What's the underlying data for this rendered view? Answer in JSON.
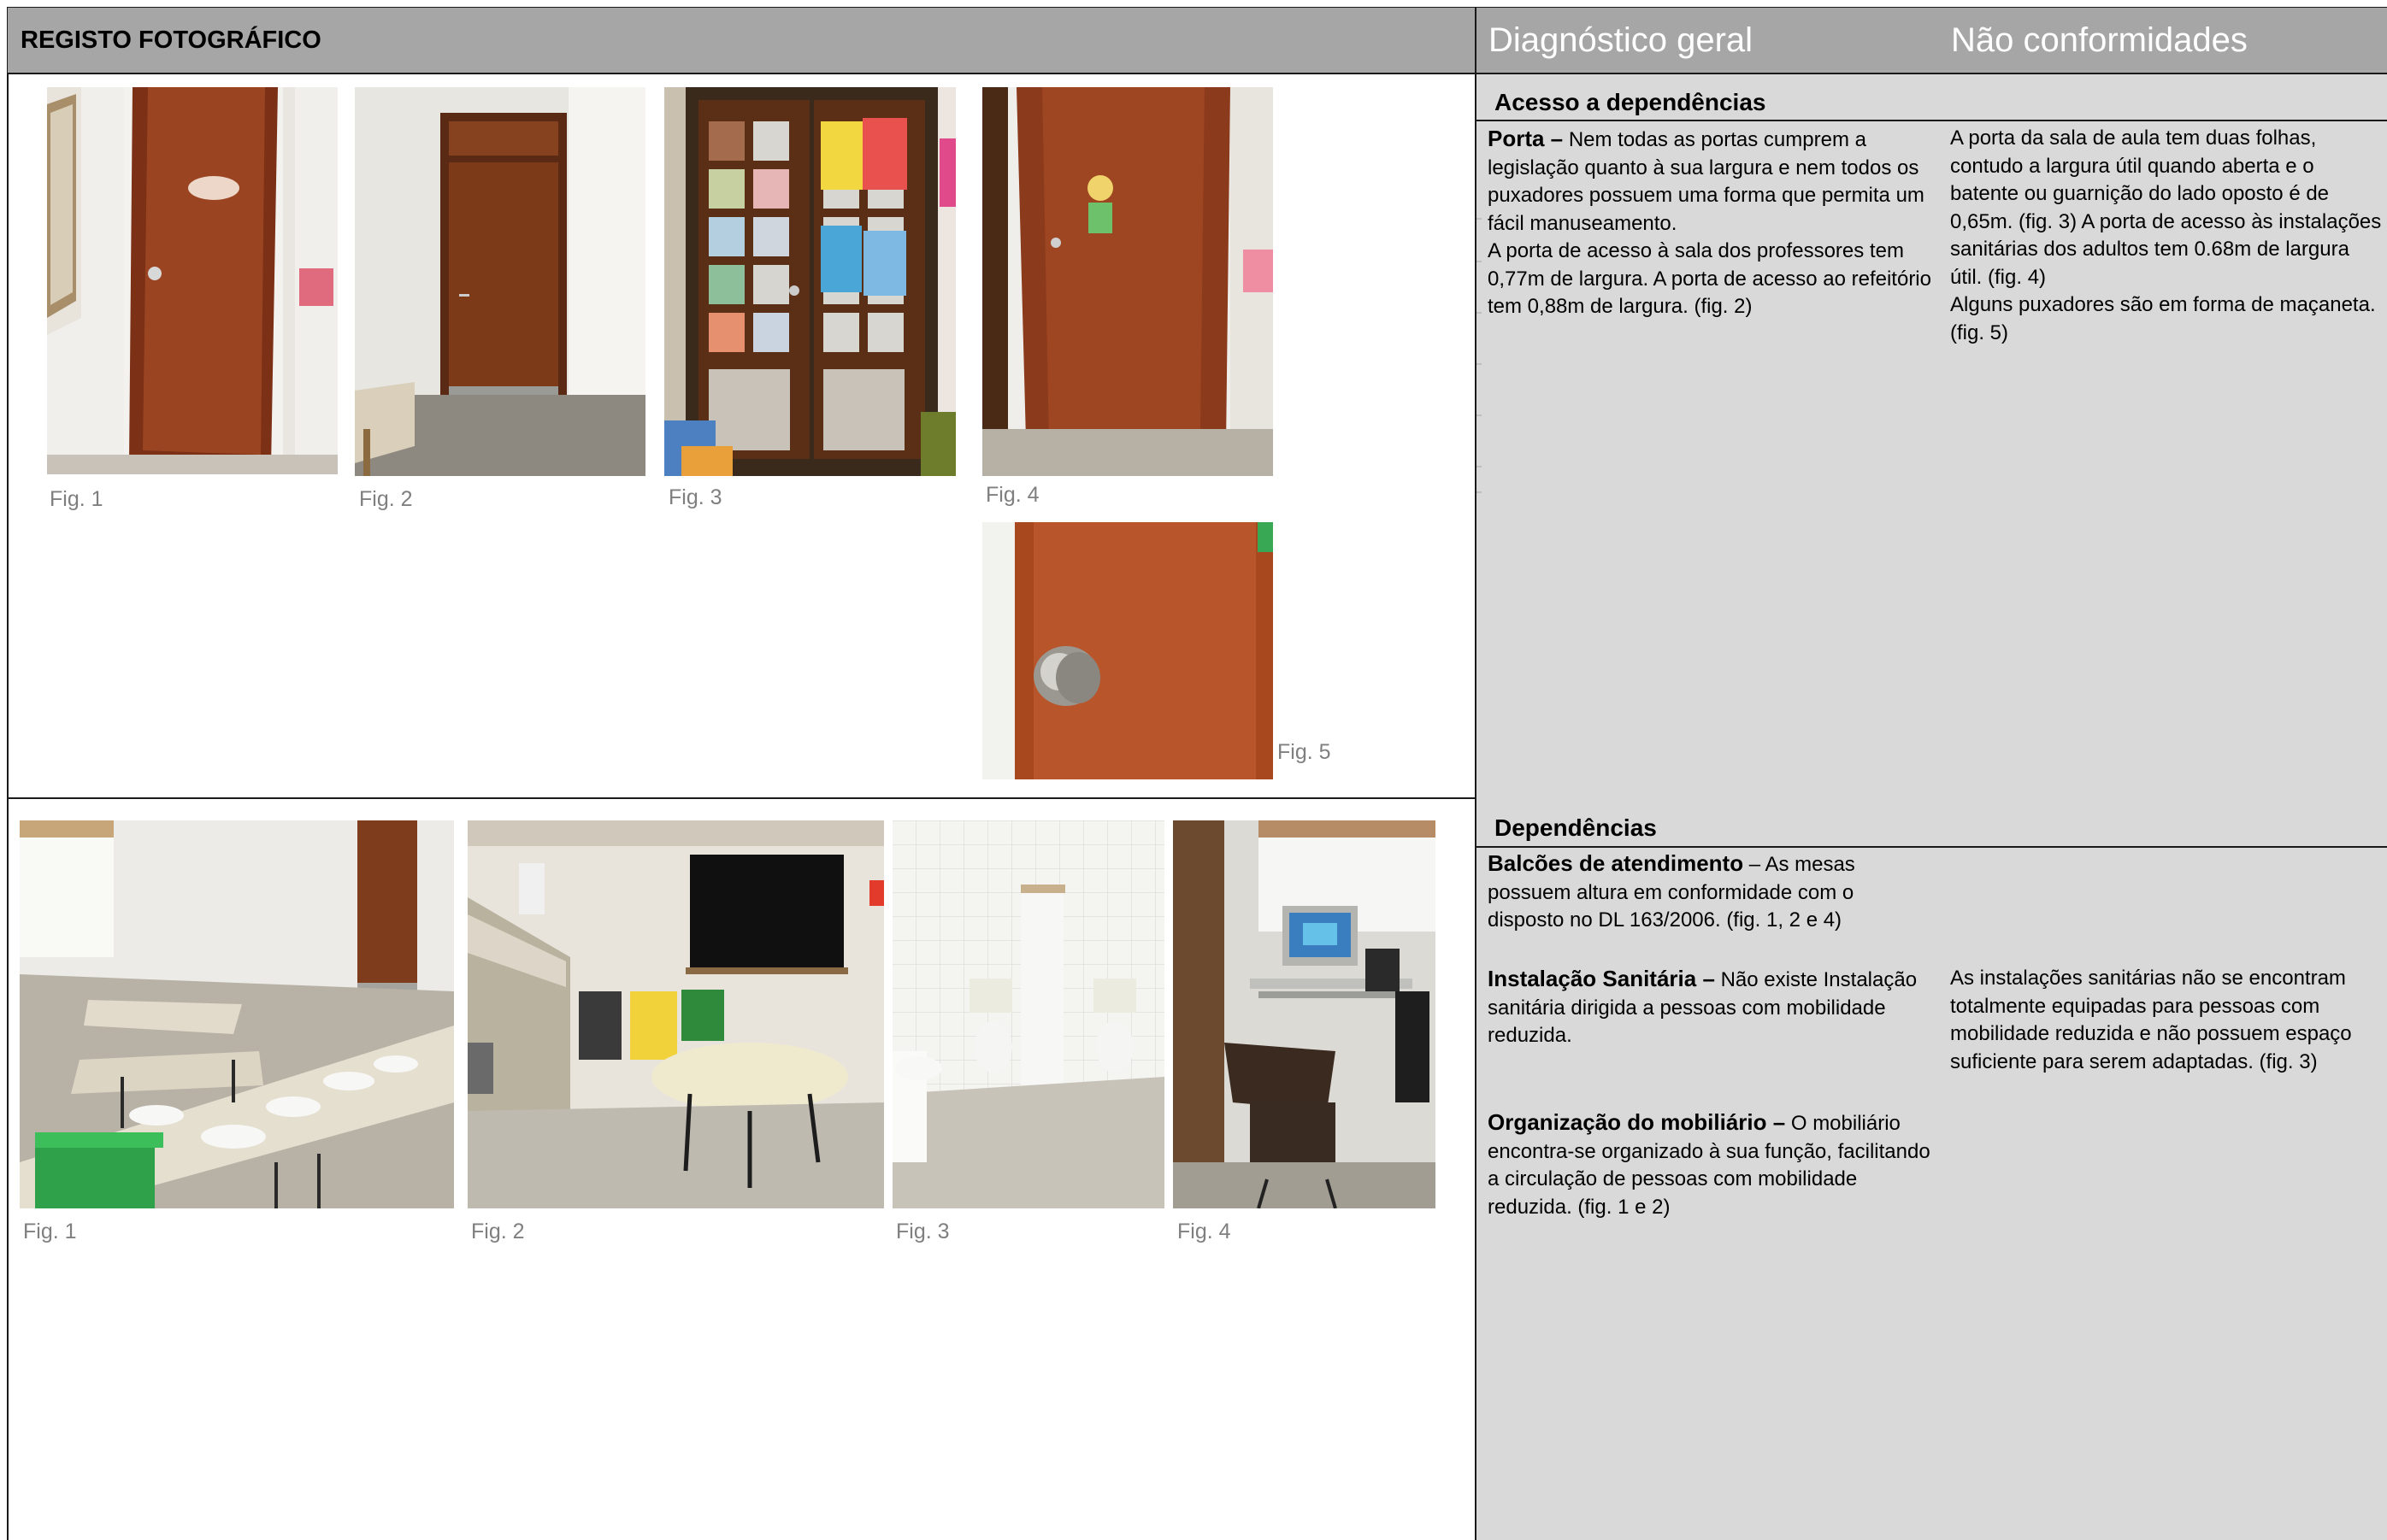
{
  "header": {
    "left_title": "REGISTO FOTOGRÁFICO",
    "col_diagnostico": "Diagnóstico geral",
    "col_nao_conformidades": "Não conformidades"
  },
  "section1": {
    "title": "Acesso a dependências",
    "captions": [
      "Fig. 1",
      "Fig. 2",
      "Fig. 3",
      "Fig. 4",
      "Fig. 5"
    ],
    "porta_label": "Porta –",
    "porta_text": " Nem todas as portas cumprem a legislação quanto à sua largura e nem todos os puxadores possuem uma forma que permita um fácil manuseamento.",
    "porta_text2": "A porta de acesso à sala dos professores tem 0,77m de largura. A porta de acesso ao refeitório tem 0,88m de largura. (fig. 2)",
    "nc_text1": "A porta da sala de aula tem duas folhas, contudo a largura útil quando aberta e o batente ou guarnição do lado oposto é de 0,65m. (fig. 3) A porta de acesso às instalações sanitárias dos adultos tem 0.68m de largura útil. (fig. 4)",
    "nc_text2": "Alguns puxadores são em forma de maçaneta. (fig. 5)"
  },
  "section2": {
    "title": "Dependências",
    "captions": [
      "Fig. 1",
      "Fig. 2",
      "Fig. 3",
      "Fig. 4"
    ],
    "balcoes_label": "Balcões de atendimento",
    "balcoes_text": " – As mesas possuem altura em conformidade com o disposto no DL 163/2006. (fig. 1, 2 e 4)",
    "sanitaria_label": "Instalação Sanitária –",
    "sanitaria_text": " Não existe Instalação sanitária dirigida a pessoas com mobilidade reduzida.",
    "sanitaria_nc": "As instalações sanitárias não se encontram totalmente equipadas para pessoas com mobilidade reduzida e não possuem espaço suficiente para serem adaptadas. (fig. 3)",
    "mobiliario_label": "Organização do mobiliário –",
    "mobiliario_text": " O mobiliário encontra-se organizado à sua função, facilitando a circulação de pessoas com mobilidade reduzida. (fig. 1 e 2)"
  },
  "colors": {
    "header_bg": "#a6a6a6",
    "panel_bg": "#d9d9d9",
    "caption": "#7f7f7f",
    "door_wood": "#8b3a1e"
  }
}
